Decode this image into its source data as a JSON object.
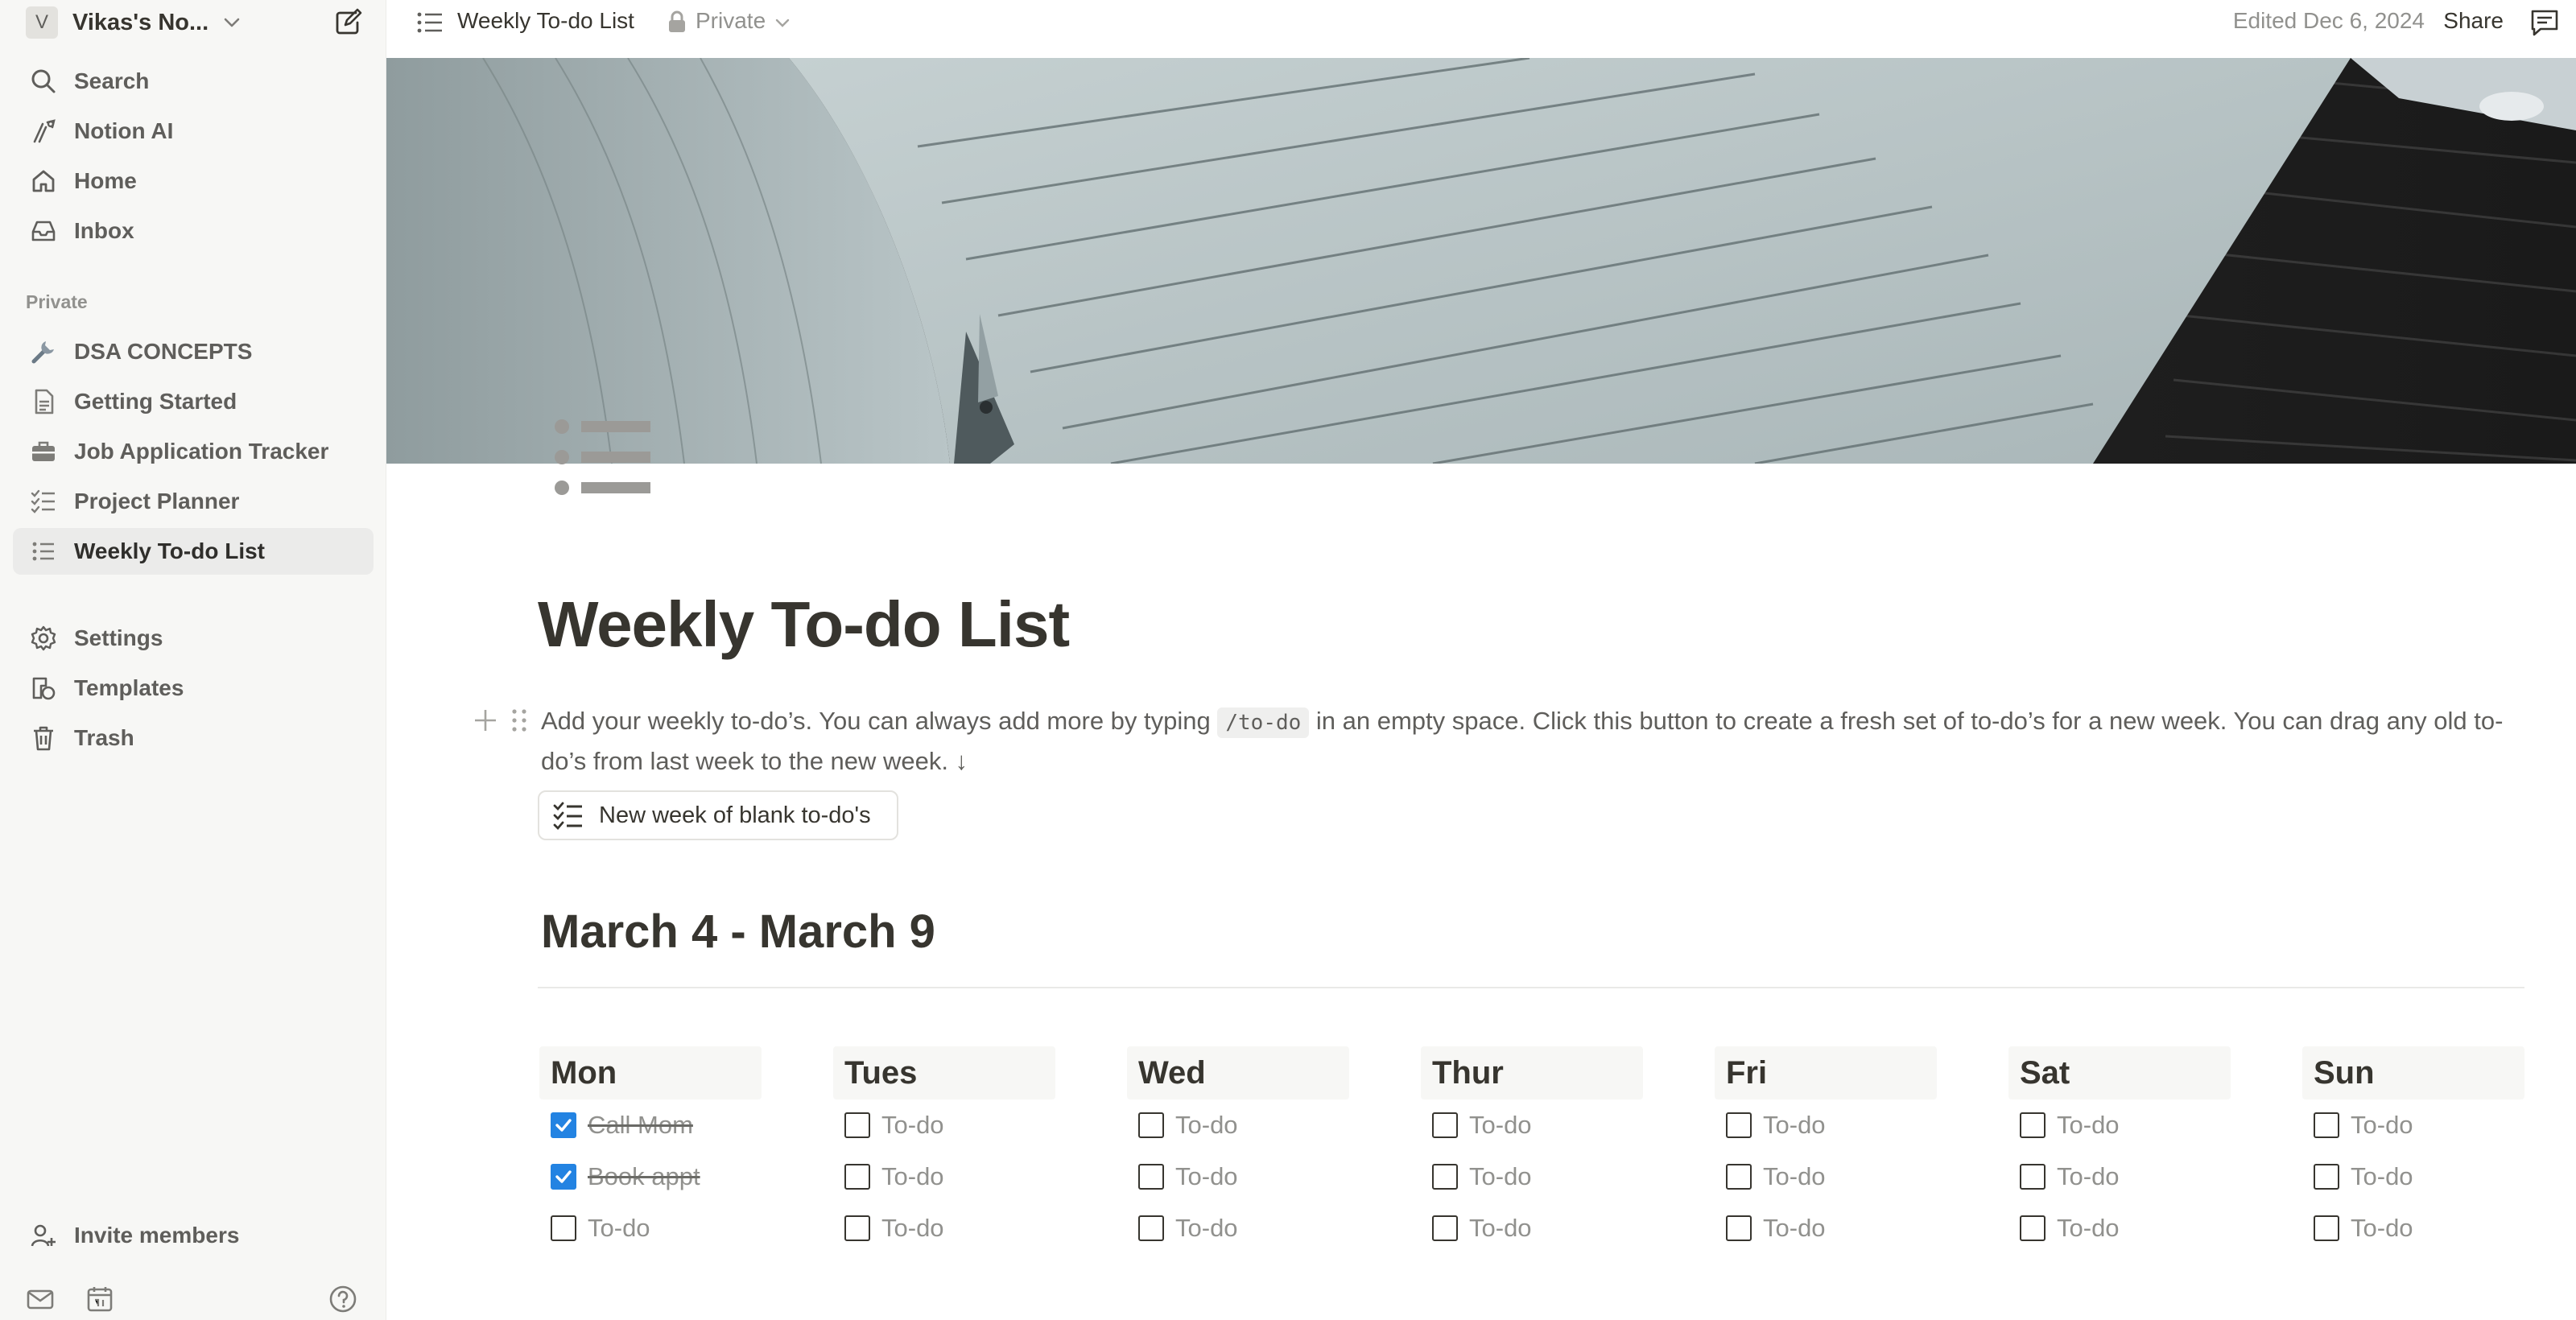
{
  "workspace": {
    "avatar_letter": "V",
    "name": "Vikas's No..."
  },
  "sidebar": {
    "top_items": [
      {
        "label": "Search",
        "icon": "search-icon"
      },
      {
        "label": "Notion AI",
        "icon": "notion-ai-icon"
      },
      {
        "label": "Home",
        "icon": "home-icon"
      },
      {
        "label": "Inbox",
        "icon": "inbox-icon"
      }
    ],
    "section_label": "Private",
    "private_items": [
      {
        "label": "DSA CONCEPTS",
        "icon": "wrench-icon"
      },
      {
        "label": "Getting Started",
        "icon": "document-icon"
      },
      {
        "label": "Job Application Tracker",
        "icon": "briefcase-icon"
      },
      {
        "label": "Project Planner",
        "icon": "checklist-icon"
      },
      {
        "label": "Weekly To-do List",
        "icon": "bullet-list-icon",
        "active": true
      }
    ],
    "bottom_items": [
      {
        "label": "Settings",
        "icon": "gear-icon"
      },
      {
        "label": "Templates",
        "icon": "templates-icon"
      },
      {
        "label": "Trash",
        "icon": "trash-icon"
      }
    ],
    "invite_label": "Invite members"
  },
  "topbar": {
    "page_title": "Weekly To-do List",
    "visibility": "Private",
    "edited": "Edited Dec 6, 2024",
    "share_label": "Share"
  },
  "page": {
    "title": "Weekly To-do List",
    "description_before": "Add your weekly to-do’s. You can always add more by typing ",
    "description_code": "/to-do",
    "description_after": " in an empty space. Click this button to create a fresh set of to-do’s for a new week. You can drag any old to-do’s from last week to the new week. ↓",
    "template_button_label": "New week of blank to-do's",
    "week_heading": "March 4 - March 9",
    "days": [
      {
        "name": "Mon",
        "todos": [
          {
            "text": "Call Mom",
            "checked": true
          },
          {
            "text": "Book appt",
            "checked": true
          },
          {
            "text": "To-do",
            "checked": false
          }
        ]
      },
      {
        "name": "Tues",
        "todos": [
          {
            "text": "To-do",
            "checked": false
          },
          {
            "text": "To-do",
            "checked": false
          },
          {
            "text": "To-do",
            "checked": false
          }
        ]
      },
      {
        "name": "Wed",
        "todos": [
          {
            "text": "To-do",
            "checked": false
          },
          {
            "text": "To-do",
            "checked": false
          },
          {
            "text": "To-do",
            "checked": false
          }
        ]
      },
      {
        "name": "Thur",
        "todos": [
          {
            "text": "To-do",
            "checked": false
          },
          {
            "text": "To-do",
            "checked": false
          },
          {
            "text": "To-do",
            "checked": false
          }
        ]
      },
      {
        "name": "Fri",
        "todos": [
          {
            "text": "To-do",
            "checked": false
          },
          {
            "text": "To-do",
            "checked": false
          },
          {
            "text": "To-do",
            "checked": false
          }
        ]
      },
      {
        "name": "Sat",
        "todos": [
          {
            "text": "To-do",
            "checked": false
          },
          {
            "text": "To-do",
            "checked": false
          },
          {
            "text": "To-do",
            "checked": false
          }
        ]
      },
      {
        "name": "Sun",
        "todos": [
          {
            "text": "To-do",
            "checked": false
          },
          {
            "text": "To-do",
            "checked": false
          },
          {
            "text": "To-do",
            "checked": false
          }
        ]
      }
    ]
  },
  "colors": {
    "sidebar_bg": "#f7f7f5",
    "text": "#37352f",
    "muted": "#91918e",
    "checkbox_accent": "#2383e2"
  }
}
